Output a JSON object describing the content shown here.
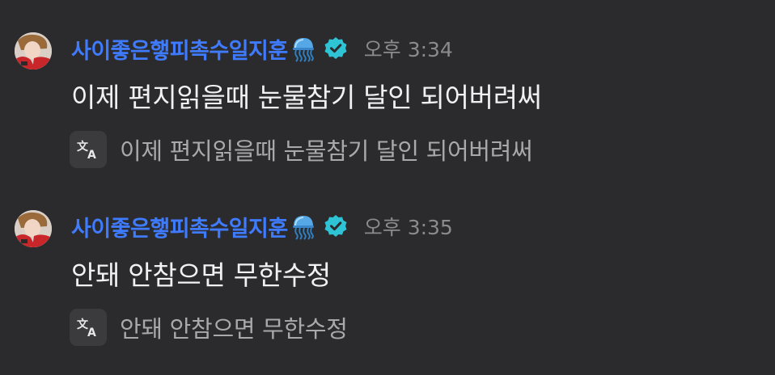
{
  "messages": [
    {
      "username": "사이좋은햏피촉수일지훈",
      "emoji": "jellyfish-emoji",
      "badge": "verified-badge-icon",
      "time": "오후 3:34",
      "text": "이제 편지읽을때 눈물참기 달인 되어버려써",
      "translated": "이제 편지읽을때 눈물참기 달인 되어버려써"
    },
    {
      "username": "사이좋은햏피촉수일지훈",
      "emoji": "jellyfish-emoji",
      "badge": "verified-badge-icon",
      "time": "오후 3:35",
      "text": "안돼 안참으면 무한수정",
      "translated": "안돼 안참으면 무한수정"
    }
  ],
  "colors": {
    "background": "#2b2b2d",
    "username": "#3f7bff",
    "badge": "#2ec4d6",
    "time": "#8a8a8f",
    "text": "#f1f1f3",
    "translated": "#a9a9ad"
  }
}
